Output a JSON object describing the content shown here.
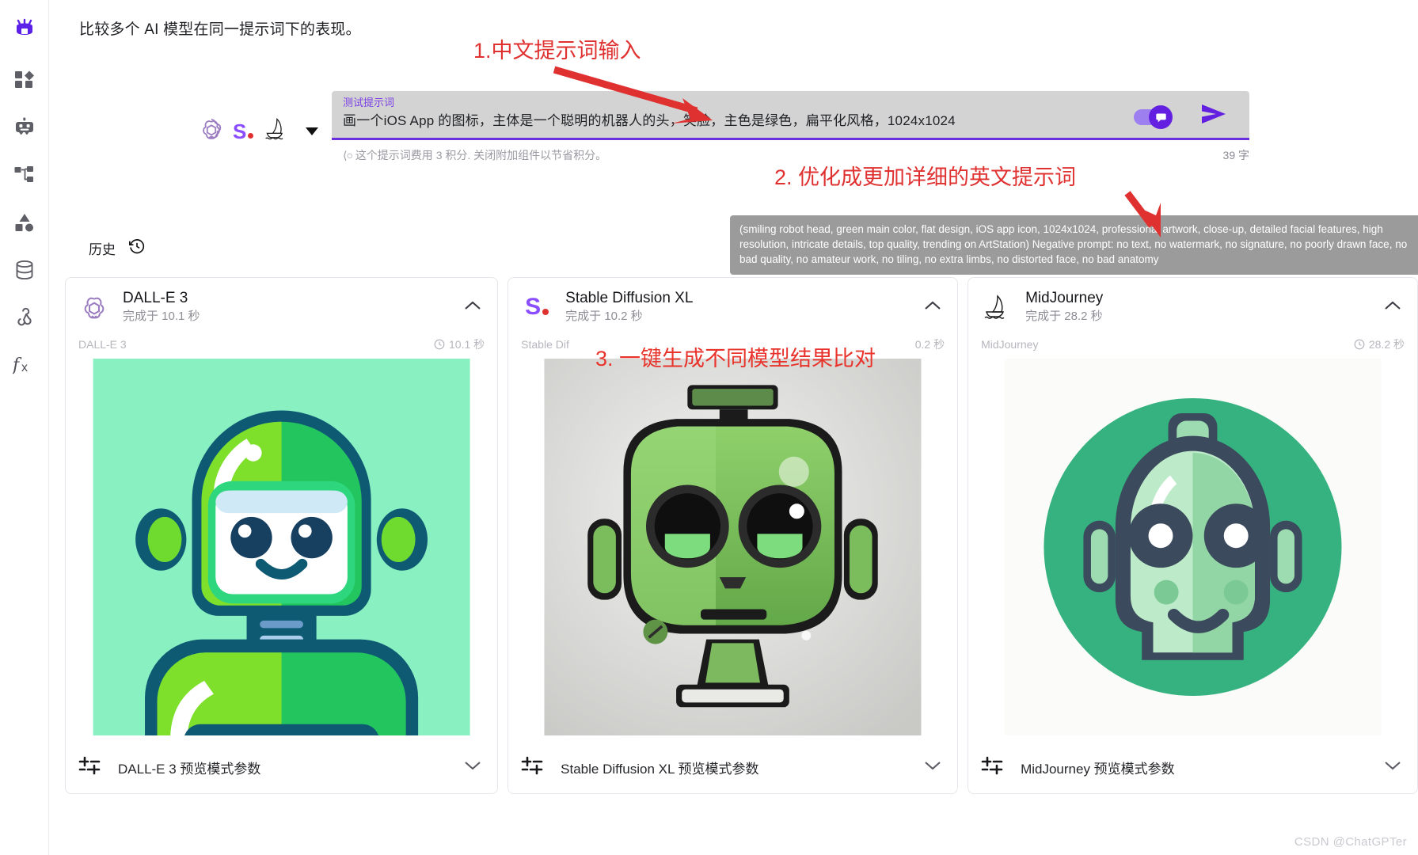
{
  "sidebar": {
    "items": [
      {
        "name": "logo-icon",
        "label": "Logo"
      },
      {
        "name": "dashboard-icon",
        "label": "Dashboard"
      },
      {
        "name": "robot-icon",
        "label": "Agents"
      },
      {
        "name": "workflow-icon",
        "label": "Workflow"
      },
      {
        "name": "shapes-icon",
        "label": "Shapes"
      },
      {
        "name": "database-icon",
        "label": "Database"
      },
      {
        "name": "webhook-icon",
        "label": "Webhook"
      },
      {
        "name": "function-icon",
        "label": "Function"
      }
    ]
  },
  "header": {
    "subtitle": "比较多个 AI 模型在同一提示词下的表现。"
  },
  "prompt": {
    "label": "测试提示词",
    "value": "画一个iOS App 的图标，主体是一个聪明的机器人的头，笑脸，主色是绿色，扁平化风格，1024x1024",
    "helper": "这个提示词费用 3 积分. 关闭附加组件以节省积分。",
    "helper_credits": "3",
    "char_count": "39 字",
    "toggle_on": true,
    "accent": "#6320e0"
  },
  "tooltip": {
    "text": "(smiling robot head, green main color, flat design, iOS app icon, 1024x1024, professional artwork, close-up, detailed facial features, high resolution, intricate details, top quality, trending on ArtStation) Negative prompt: no text, no watermark, no signature, no poorly drawn face, no bad quality, no amateur work, no tiling, no extra limbs, no distorted face, no bad anatomy"
  },
  "history": {
    "label": "历史"
  },
  "cards": [
    {
      "title": "DALL-E 3",
      "subtitle": "完成于 10.1 秒",
      "meta_name": "DALL-E 3",
      "meta_duration": "10.1 秒",
      "footer_label": "DALL-E 3 预览模式参数",
      "logo": "openai-logo-icon"
    },
    {
      "title": "Stable Diffusion XL",
      "subtitle": "完成于 10.2 秒",
      "meta_name": "Stable Dif",
      "meta_duration": "0.2 秒",
      "footer_label": "Stable Diffusion XL 预览模式参数",
      "logo": "stability-logo-icon"
    },
    {
      "title": "MidJourney",
      "subtitle": "完成于 28.2 秒",
      "meta_name": "MidJourney",
      "meta_duration": "28.2 秒",
      "footer_label": "MidJourney 预览模式参数",
      "logo": "midjourney-logo-icon"
    }
  ],
  "annotations": [
    {
      "id": "1",
      "text": "1.中文提示词输入",
      "color": "#e03131"
    },
    {
      "id": "2",
      "text": "2. 优化成更加详细的英文提示词",
      "color": "#e03131"
    },
    {
      "id": "3",
      "text": "3. 一键生成不同模型结果比对",
      "color": "#e8342c"
    }
  ],
  "watermark": "CSDN @ChatGPTer"
}
